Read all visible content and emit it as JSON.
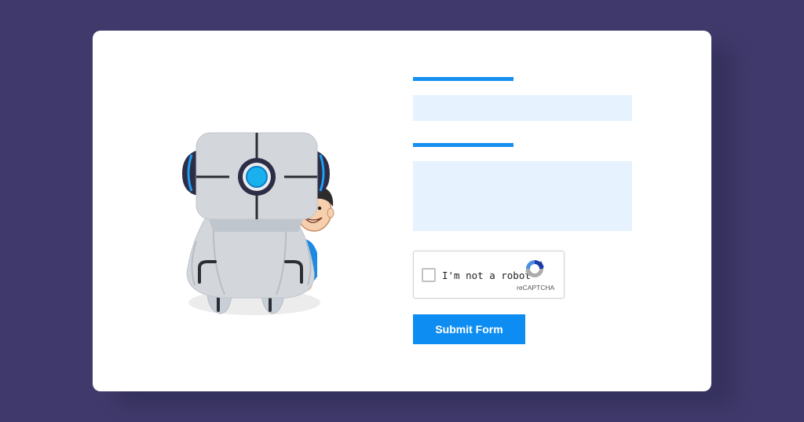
{
  "form": {
    "field1_value": "",
    "field2_value": "",
    "recaptcha": {
      "label": "I'm not a robot",
      "brand": "reCAPTCHA",
      "checked": false
    },
    "submit_label": "Submit Form"
  },
  "colors": {
    "page_background": "#3f3a6b",
    "card_background": "#ffffff",
    "accent": "#1590f0",
    "field_background": "#e6f3fe",
    "button_background": "#0d8df2"
  },
  "icons": [
    "robot-illustration",
    "person-peeking-illustration",
    "recaptcha-logo-icon",
    "checkbox-icon"
  ]
}
